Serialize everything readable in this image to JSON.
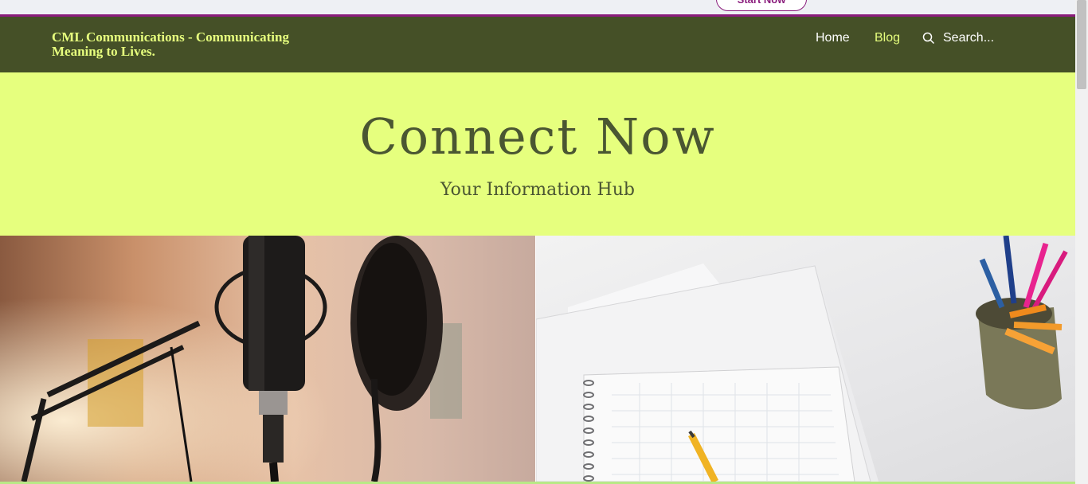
{
  "promo": {
    "button_label": "Start Now"
  },
  "header": {
    "site_title": "CML Communications - Communicating Meaning to Lives.",
    "nav": {
      "home": "Home",
      "blog": "Blog"
    },
    "search": {
      "placeholder": "Search..."
    }
  },
  "hero": {
    "title": "Connect Now",
    "subtitle": "Your Information Hub"
  },
  "colors": {
    "header_bg": "#455027",
    "hero_bg": "#e6ff7e",
    "accent_lime": "#e7ff7e",
    "promo_accent": "#8a1c7c",
    "hero_text": "#4a5632"
  },
  "icons": {
    "search": "search-icon"
  }
}
